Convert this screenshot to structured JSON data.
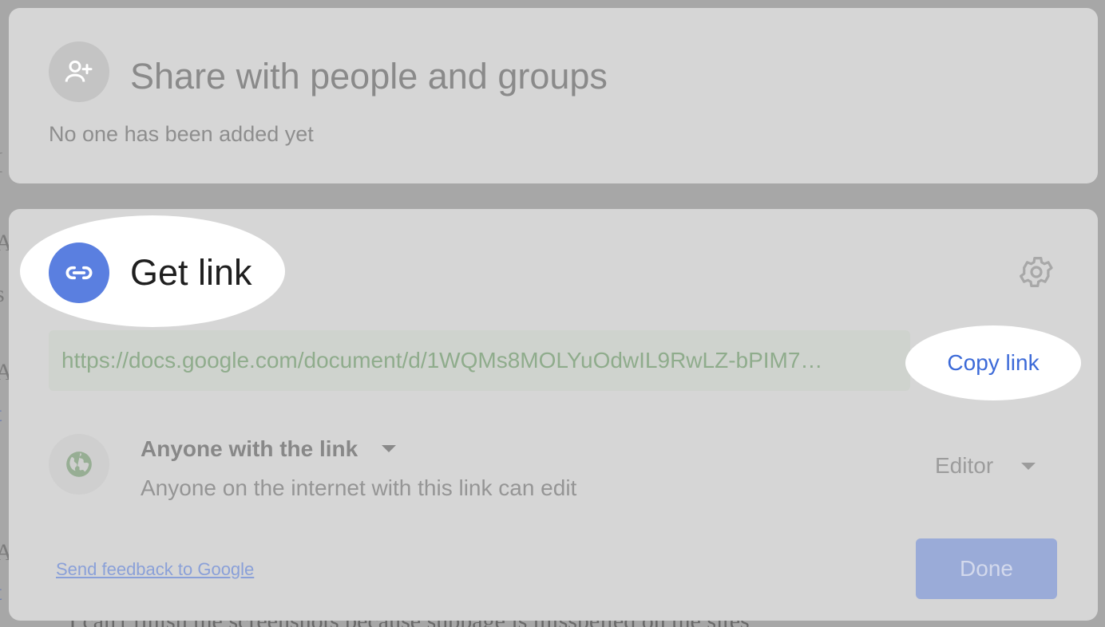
{
  "background": {
    "bottom_text": "I can't finish the screenshots because subpage is misspelled on the sites"
  },
  "share_card": {
    "title": "Share with people and groups",
    "subtitle": "No one has been added yet",
    "icon": "person-add-icon"
  },
  "link_card": {
    "title": "Get link",
    "icon": "link-icon",
    "settings_icon": "gear-icon",
    "url": "https://docs.google.com/document/d/1WQMs8MOLYuOdwIL9RwLZ-bPIM7…",
    "copy_label": "Copy link",
    "access": {
      "icon": "globe-icon",
      "label": "Anyone with the link",
      "description": "Anyone on the internet with this link can edit"
    },
    "role": {
      "label": "Editor"
    },
    "feedback_label": "Send feedback to Google",
    "done_label": "Done"
  },
  "colors": {
    "accent": "#5a7fe0",
    "copy_link": "#3c6ad8",
    "done_button": "#9aabd8"
  }
}
